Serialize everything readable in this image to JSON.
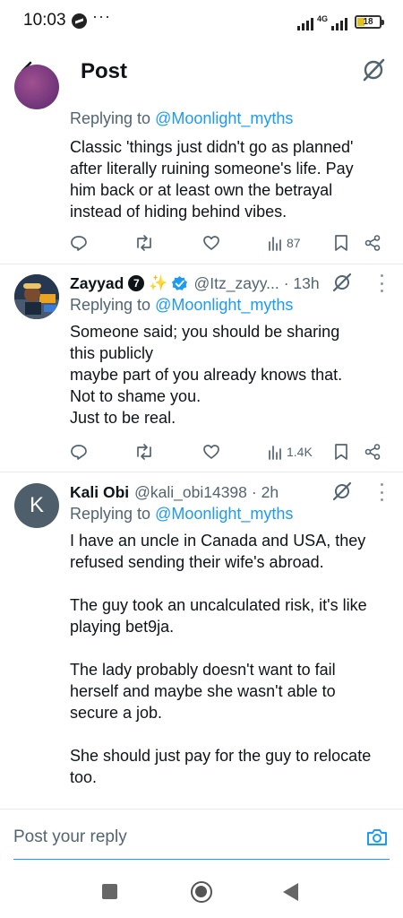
{
  "status_bar": {
    "time": "10:03",
    "overflow": "···",
    "network": "4G",
    "battery": "18"
  },
  "header": {
    "title": "Post"
  },
  "tweets": [
    {
      "reply_prefix": "Replying to ",
      "reply_handle": "@Moonlight_myths",
      "text": "Classic 'things just didn't go as planned' after literally ruining someone's life. Pay him back or at least own the betrayal instead of hiding behind vibes.",
      "views": "87"
    },
    {
      "name": "Zayyad",
      "badge_num": "7",
      "sparkle": "✨",
      "handle": "@Itz_zayy...",
      "time": "· 13h",
      "reply_prefix": "Replying to ",
      "reply_handle": "@Moonlight_myths",
      "text": "Someone said; you should be sharing\nthis  publicly\nmaybe part of you already knows that.\nNot to shame you.\nJust to be real.",
      "views": "1.4K"
    },
    {
      "avatar_letter": "K",
      "name": "Kali Obi",
      "handle": "@kali_obi14398",
      "time": "· 2h",
      "reply_prefix": "Replying to ",
      "reply_handle": "@Moonlight_myths",
      "text": "I have an uncle in Canada and USA, they refused sending their wife's abroad.\n\nThe guy took an uncalculated risk, it's like playing bet9ja.\n\nThe lady probably doesn't want to fail herself and maybe she wasn't able to secure a job.\n\nShe should just pay for the guy to relocate too."
    }
  ],
  "composer": {
    "placeholder": "Post your reply"
  },
  "colors": {
    "accent": "#1d9bf0",
    "text": "#0f1419",
    "muted": "#536471",
    "verified": "#1d9bf0"
  }
}
